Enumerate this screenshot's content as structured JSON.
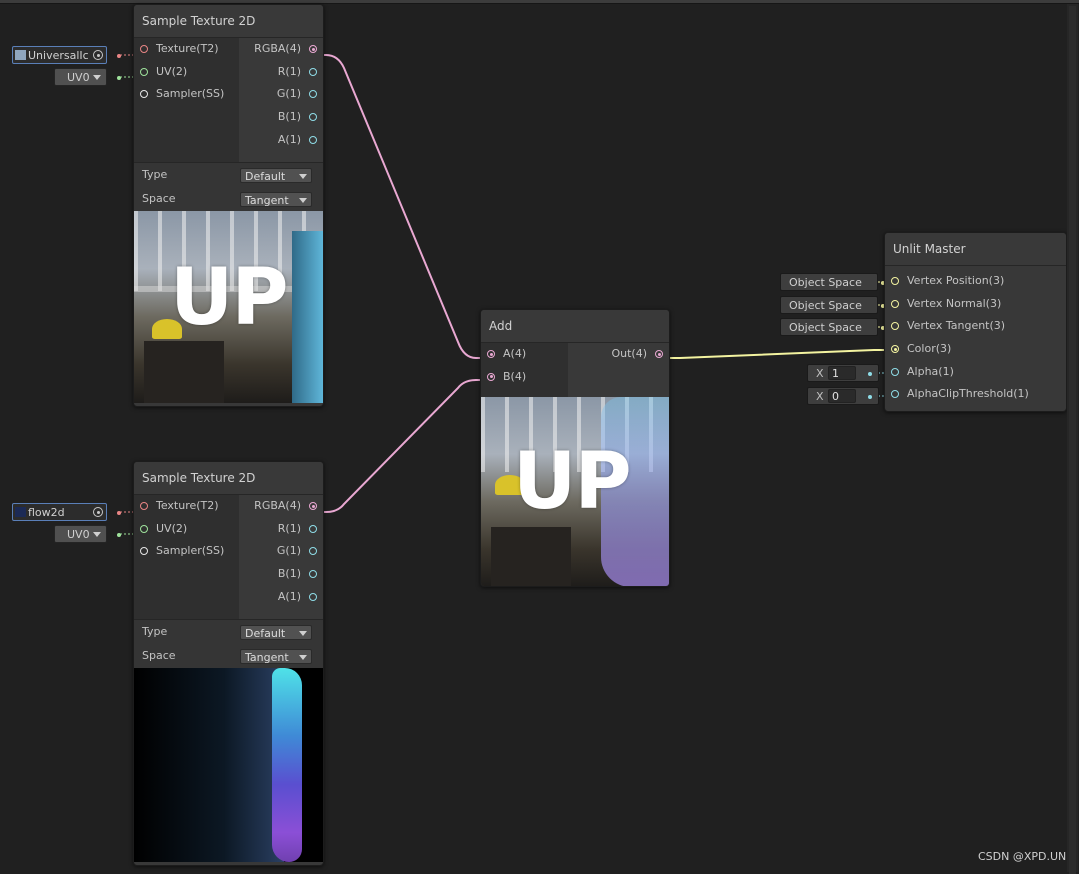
{
  "nodes": {
    "sample1": {
      "title": "Sample Texture 2D",
      "inputs": [
        "Texture(T2)",
        "UV(2)",
        "Sampler(SS)"
      ],
      "outputs": [
        "RGBA(4)",
        "R(1)",
        "G(1)",
        "B(1)",
        "A(1)"
      ],
      "settings": [
        {
          "label": "Type",
          "value": "Default"
        },
        {
          "label": "Space",
          "value": "Tangent"
        }
      ],
      "texture_field": "UniversalIco",
      "uv_field": "UV0",
      "preview_text": "UP"
    },
    "sample2": {
      "title": "Sample Texture 2D",
      "inputs": [
        "Texture(T2)",
        "UV(2)",
        "Sampler(SS)"
      ],
      "outputs": [
        "RGBA(4)",
        "R(1)",
        "G(1)",
        "B(1)",
        "A(1)"
      ],
      "settings": [
        {
          "label": "Type",
          "value": "Default"
        },
        {
          "label": "Space",
          "value": "Tangent"
        }
      ],
      "texture_field": "flow2d",
      "uv_field": "UV0"
    },
    "add": {
      "title": "Add",
      "inputs": [
        "A(4)",
        "B(4)"
      ],
      "outputs": [
        "Out(4)"
      ],
      "preview_text": "UP"
    },
    "master": {
      "title": "Unlit Master",
      "inputs": [
        "Vertex Position(3)",
        "Vertex Normal(3)",
        "Vertex Tangent(3)",
        "Color(3)",
        "Alpha(1)",
        "AlphaClipThreshold(1)"
      ],
      "space_fields": [
        "Object Space",
        "Object Space",
        "Object Space"
      ],
      "alpha": {
        "label": "X",
        "value": "1"
      },
      "clip": {
        "label": "X",
        "value": "0"
      }
    }
  },
  "watermark": "CSDN @XPD.UN",
  "colors": {
    "background": "#202020",
    "node": "#383838",
    "vector4_wire": "#e9a8d2",
    "vector3_wire": "#f3f3a0",
    "float_port": "#8fdde8",
    "texture_port": "#e98585",
    "uv_port": "#9fe39c"
  }
}
